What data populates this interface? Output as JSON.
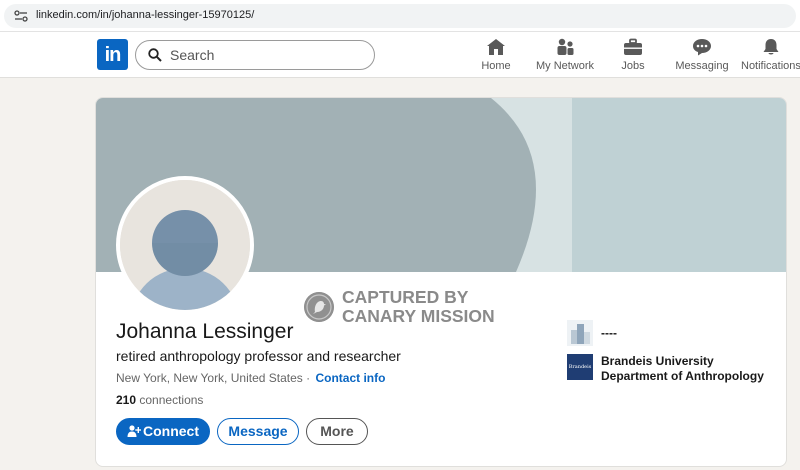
{
  "browser": {
    "url": "linkedin.com/in/johanna-lessinger-15970125/"
  },
  "nav": {
    "logo_text": "in",
    "search_placeholder": "Search",
    "items": [
      {
        "label": "Home",
        "icon": "home-icon"
      },
      {
        "label": "My Network",
        "icon": "network-icon"
      },
      {
        "label": "Jobs",
        "icon": "briefcase-icon"
      },
      {
        "label": "Messaging",
        "icon": "messaging-icon"
      },
      {
        "label": "Notifications",
        "icon": "bell-icon"
      }
    ]
  },
  "profile": {
    "name": "Johanna Lessinger",
    "headline": "retired anthropology professor and researcher",
    "location": "New York, New York, United States",
    "location_separator": "·",
    "contact_info": "Contact info",
    "connections_count": "210",
    "connections_label": "connections",
    "buttons": {
      "connect": "Connect",
      "message": "Message",
      "more": "More"
    }
  },
  "sidebar": {
    "experience": {
      "label": "----"
    },
    "education": {
      "logo_text": "Brandeis",
      "line1": "Brandeis University",
      "line2": "Department of Anthropology"
    }
  },
  "watermark": {
    "line1": "CAPTURED BY",
    "line2": "CANARY MISSION"
  },
  "colors": {
    "brand": "#0a66c2",
    "banner_dark": "#a2b1b5",
    "banner_light": "#d7e2e3",
    "banner_right": "#bfd1d4"
  }
}
